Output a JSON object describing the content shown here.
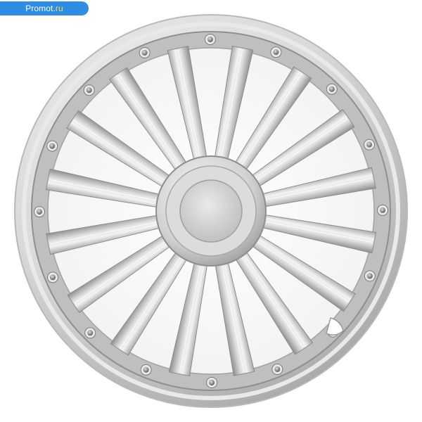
{
  "badge": {
    "brand": "Promot.",
    "tld": "ru",
    "color": "#2f8de4",
    "tld_color": "#ffd24d"
  },
  "image": {
    "subject": "wheel-cover",
    "spokes": 16,
    "bolts": 16
  },
  "colors": {
    "rim_light": "#f4f4f4",
    "rim_mid": "#c9c9c9",
    "rim_dark": "#8b8b8b",
    "spoke_light": "#eeeeee",
    "spoke_dark": "#9a9a9a",
    "hub": "#d3d3d3",
    "bolt": "#7d7d7d"
  }
}
